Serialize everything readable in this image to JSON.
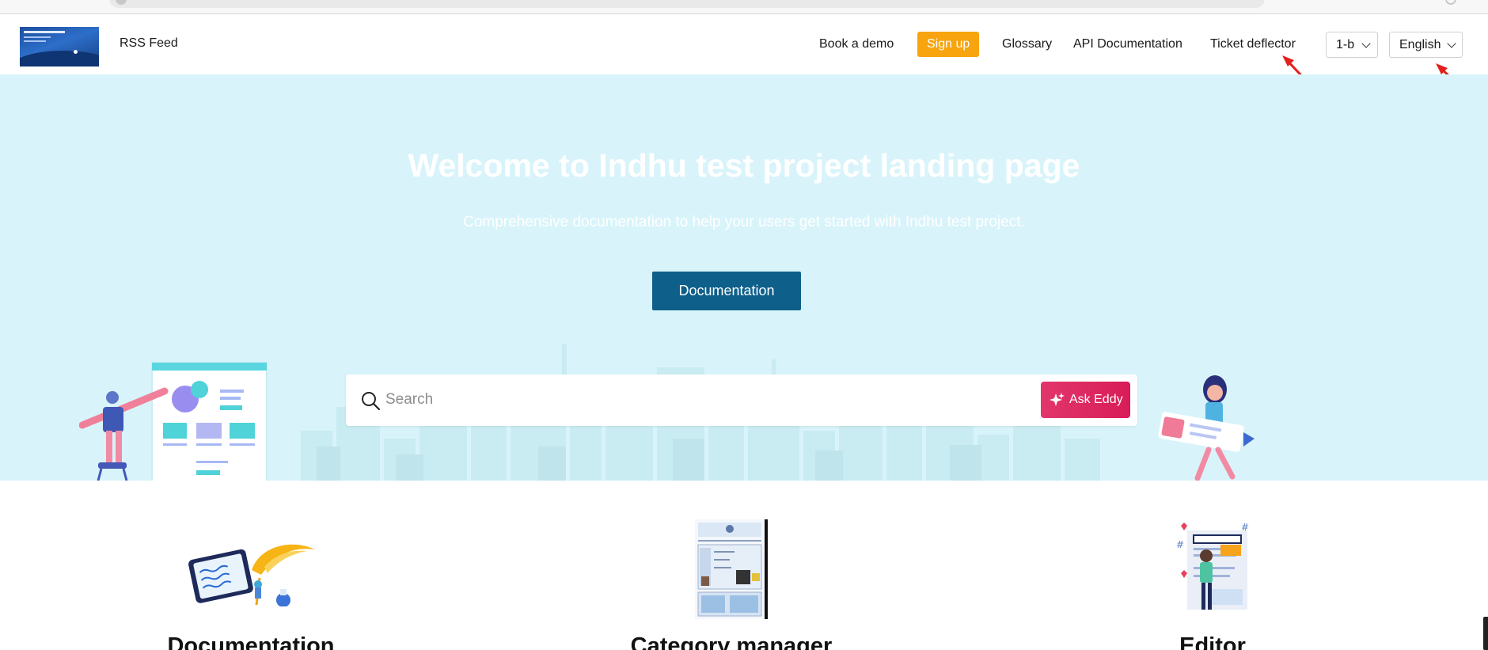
{
  "header": {
    "rss_label": "RSS Feed",
    "book_demo": "Book a demo",
    "signup": "Sign up",
    "glossary": "Glossary",
    "api_docs": "API Documentation",
    "ticket_deflector": "Ticket deflector",
    "version_select": "1-b",
    "language_select": "English"
  },
  "hero": {
    "title": "Welcome to Indhu test project landing page",
    "subtitle": "Comprehensive documentation to help your users get started with Indhu test project.",
    "cta": "Documentation",
    "search_placeholder": "Search",
    "ask_button": "Ask Eddy"
  },
  "features": [
    {
      "title": "Documentation"
    },
    {
      "title": "Category manager"
    },
    {
      "title": "Editor"
    }
  ],
  "colors": {
    "hero_bg": "#d8f4fa",
    "primary": "#0e5f8a",
    "signup": "#f7a40e",
    "ask_eddy": "#e2366d",
    "annotation": "#e3211c"
  },
  "icons": [
    "search-icon",
    "sparkle-icon",
    "chevron-down-icon",
    "annotation-arrow-icon"
  ]
}
